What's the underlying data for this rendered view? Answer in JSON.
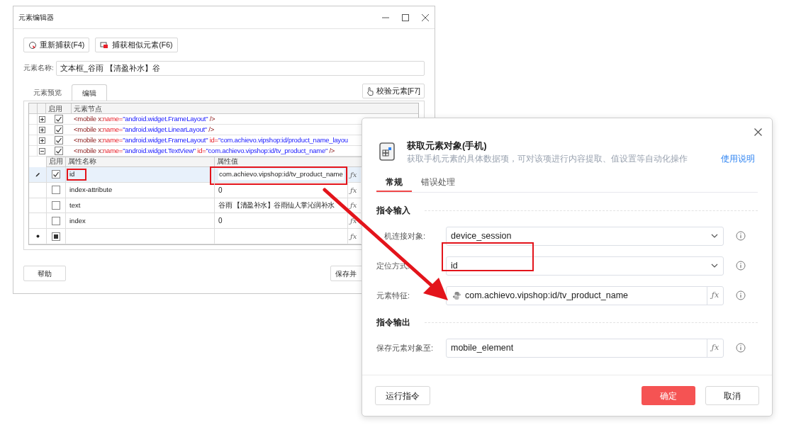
{
  "editor_window": {
    "title": "元素编辑器",
    "toolbar": [
      {
        "label": "重新捕获(F4)",
        "kind": "recapture"
      },
      {
        "label": "捕获相似元素(F6)",
        "kind": "similar"
      }
    ],
    "name_field": {
      "label": "元素名称:",
      "value": "文本框_谷雨 【清盈补水】谷"
    },
    "tabs": [
      {
        "label": "元素预览",
        "selected": false
      },
      {
        "label": "编辑",
        "selected": true
      }
    ],
    "verify_button": "校验元素[F7]",
    "node_table": {
      "columns": [
        "启用",
        "元素节点"
      ],
      "rows": [
        {
          "expanded": false,
          "checked": true,
          "parts": [
            {
              "text": "<mobile x:",
              "kind": "tag"
            },
            {
              "text": "name=",
              "kind": "attr"
            },
            {
              "text": "\"android.widget.FrameLayout\"",
              "kind": "value"
            },
            {
              "text": " />",
              "kind": "tag"
            }
          ]
        },
        {
          "expanded": false,
          "checked": true,
          "parts": [
            {
              "text": "<mobile x:",
              "kind": "tag"
            },
            {
              "text": "name=",
              "kind": "attr"
            },
            {
              "text": "\"android.widget.LinearLayout\"",
              "kind": "value"
            },
            {
              "text": " />",
              "kind": "tag"
            }
          ]
        },
        {
          "expanded": false,
          "checked": true,
          "parts": [
            {
              "text": "<mobile x:",
              "kind": "tag"
            },
            {
              "text": "name=",
              "kind": "attr"
            },
            {
              "text": "\"android.widget.FrameLayout\"",
              "kind": "value"
            },
            {
              "text": " id=",
              "kind": "attr"
            },
            {
              "text": "\"com.achievo.vipshop:id/product_name_layou",
              "kind": "value"
            }
          ]
        },
        {
          "expanded": true,
          "checked": true,
          "parts": [
            {
              "text": "<mobile x:",
              "kind": "tag"
            },
            {
              "text": "name=",
              "kind": "attr"
            },
            {
              "text": "\"android.widget.TextView\"",
              "kind": "value"
            },
            {
              "text": " id=",
              "kind": "attr"
            },
            {
              "text": "\"com.achievo.vipshop:id/tv_product_name\"",
              "kind": "value"
            },
            {
              "text": " />",
              "kind": "tag"
            }
          ]
        }
      ]
    },
    "attr_table": {
      "columns": [
        "启用",
        "属性名称",
        "属性值"
      ],
      "rows": [
        {
          "kind": "existing",
          "selected": true,
          "checked": true,
          "name": "id",
          "value": "com.achievo.vipshop:id/tv_product_name",
          "name_highlighted": true,
          "value_highlighted": true,
          "fx": "ƒx"
        },
        {
          "kind": "existing",
          "selected": false,
          "checked": false,
          "name": "index-attribute",
          "value": "0",
          "name_highlighted": false,
          "value_highlighted": false,
          "fx": "ƒx"
        },
        {
          "kind": "existing",
          "selected": false,
          "checked": false,
          "name": "text",
          "value": "谷雨 【清盈补水】谷雨仙人掌沁润补水",
          "name_highlighted": false,
          "value_highlighted": false,
          "fx": "ƒx"
        },
        {
          "kind": "existing",
          "selected": false,
          "checked": false,
          "name": "index",
          "value": "0",
          "name_highlighted": false,
          "value_highlighted": false,
          "fx": "ƒx"
        },
        {
          "kind": "new",
          "selected": false,
          "indeterminate": true,
          "name_highlighted": false,
          "value_highlighted": false,
          "fx": "ƒx"
        }
      ]
    },
    "buttons": [
      "帮助",
      "保存并"
    ]
  },
  "dialog": {
    "title": "获取元素对象(手机)",
    "subtitle": "获取手机元素的具体数据项，可对该项进行内容提取、值设置等自动化操作",
    "help_link": "使用说明",
    "tabs": [
      {
        "label": "常规",
        "selected": true
      },
      {
        "label": "错误处理",
        "selected": false
      }
    ],
    "sections": [
      {
        "title": "指令输入",
        "fields": [
          {
            "label": "机连接对象:",
            "kind": "select",
            "value": "device_session",
            "highlighted": false
          },
          {
            "label": "定位方式:",
            "kind": "select",
            "value": "id",
            "highlighted": true
          },
          {
            "label": "元素特征:",
            "kind": "expression",
            "value": "com.achievo.vipshop:id/tv_product_name",
            "fx": "ƒx",
            "highlighted": false
          }
        ]
      },
      {
        "title": "指令输出",
        "fields": [
          {
            "label": "保存元素对象至:",
            "kind": "variable",
            "value": "mobile_element",
            "fx": "ƒx",
            "highlighted": false
          }
        ]
      }
    ],
    "footer": {
      "run_button": "运行指令",
      "ok_button": "确定",
      "cancel_button": "取消"
    }
  }
}
